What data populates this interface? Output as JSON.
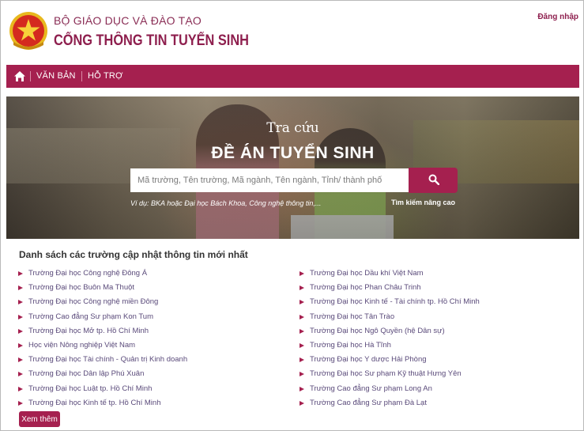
{
  "header": {
    "ministry": "BỘ GIÁO DỤC VÀ ĐÀO TẠO",
    "portal_title": "CỔNG THÔNG TIN TUYỂN SINH",
    "login": "Đăng nhập",
    "emblem_icon": "national-emblem-icon"
  },
  "nav": {
    "home_icon": "home-icon",
    "items": [
      {
        "label": "VĂN BẢN"
      },
      {
        "label": "HỖ TRỢ"
      }
    ]
  },
  "hero": {
    "subtitle": "Tra cứu",
    "title": "ĐỀ ÁN TUYỂN SINH",
    "search_placeholder": "Mã trường, Tên trường, Mã ngành, Tên ngành, Tỉnh/ thành phố",
    "search_icon": "search-icon",
    "example": "Ví dụ: BKA hoặc Đại học Bách Khoa, Công nghệ thông tin,...",
    "advanced_search": "Tìm kiếm nâng cao"
  },
  "updates": {
    "title": "Danh sách các trường cập nhật thông tin mới nhất",
    "left": [
      "Trường Đại học Công nghệ Đông Á",
      "Trường Đại học Buôn Ma Thuột",
      "Trường Đại học Công nghệ miền Đông",
      "Trường Cao đẳng Sư phạm Kon Tum",
      "Trường Đại học Mở tp. Hồ Chí Minh",
      "Học viện Nông nghiệp Việt Nam",
      "Trường Đại học Tài chính - Quản trị Kinh doanh",
      "Trường Đại học Dân lập Phú Xuân",
      "Trường Đại học Luật tp. Hồ Chí Minh",
      "Trường Đại học Kinh tế tp. Hồ Chí Minh"
    ],
    "right": [
      "Trường Đại học Dầu khí Việt Nam",
      "Trường Đại học Phan Châu Trinh",
      "Trường Đại học Kinh tế - Tài chính tp. Hồ Chí Minh",
      "Trường Đại học Tân Trào",
      "Trường Đại học Ngô Quyền (hệ Dân sự)",
      "Trường Đại học Hà Tĩnh",
      "Trường Đại học Y dược Hải Phòng",
      "Trường Đại học Sư phạm Kỹ thuật Hưng Yên",
      "Trường Cao đẳng Sư phạm Long An",
      "Trường Cao đẳng Sư phạm Đà Lạt"
    ],
    "more_button": "Xem thêm"
  },
  "colors": {
    "brand": "#a5204f",
    "brand_dark": "#8e1f4e",
    "link": "#5a4a7a"
  }
}
